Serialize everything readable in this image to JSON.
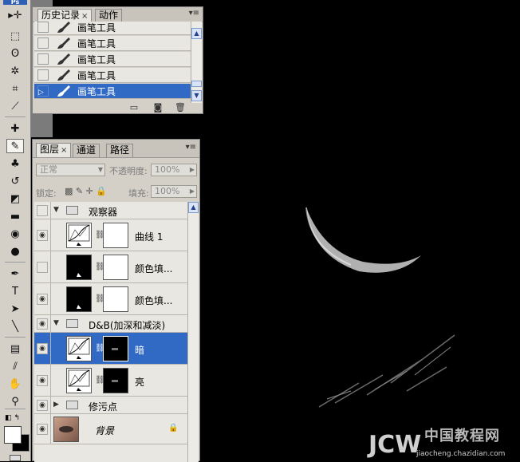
{
  "toolbox": {
    "logo": "Ps",
    "tools": [
      {
        "name": "move-icon",
        "glyph": "▸✛"
      },
      {
        "name": "marquee-icon",
        "glyph": "⬚"
      },
      {
        "name": "lasso-icon",
        "glyph": "ʘ"
      },
      {
        "name": "magic-wand-icon",
        "glyph": "✲"
      },
      {
        "name": "crop-icon",
        "glyph": "⌗"
      },
      {
        "name": "slice-icon",
        "glyph": "⟋"
      },
      {
        "name": "healing-brush-icon",
        "glyph": "✚"
      },
      {
        "name": "brush-icon",
        "glyph": "✎"
      },
      {
        "name": "clone-stamp-icon",
        "glyph": "♣"
      },
      {
        "name": "history-brush-icon",
        "glyph": "↺"
      },
      {
        "name": "eraser-icon",
        "glyph": "◩"
      },
      {
        "name": "gradient-icon",
        "glyph": "▬"
      },
      {
        "name": "blur-icon",
        "glyph": "◉"
      },
      {
        "name": "dodge-icon",
        "glyph": "●"
      },
      {
        "name": "pen-icon",
        "glyph": "✒"
      },
      {
        "name": "type-icon",
        "glyph": "T"
      },
      {
        "name": "path-select-icon",
        "glyph": "➤"
      },
      {
        "name": "line-icon",
        "glyph": "╲"
      },
      {
        "name": "notes-icon",
        "glyph": "▤"
      },
      {
        "name": "eyedropper-icon",
        "glyph": "⫽"
      },
      {
        "name": "hand-icon",
        "glyph": "✋"
      },
      {
        "name": "zoom-icon",
        "glyph": "⚲"
      }
    ]
  },
  "history": {
    "tabs": [
      {
        "label": "历史记录",
        "close": "×"
      },
      {
        "label": "动作"
      }
    ],
    "rows": [
      {
        "label": "画笔工具",
        "selected": false
      },
      {
        "label": "画笔工具",
        "selected": false
      },
      {
        "label": "画笔工具",
        "selected": false
      },
      {
        "label": "画笔工具",
        "selected": false
      },
      {
        "label": "画笔工具",
        "selected": true
      }
    ],
    "footer": [
      "new-doc-icon",
      "snapshot-icon",
      "trash-icon"
    ]
  },
  "layers_panel": {
    "tabs": [
      {
        "label": "图层",
        "close": "×"
      },
      {
        "label": "通道"
      },
      {
        "label": "路径"
      }
    ],
    "blend_mode": "正常",
    "opacity_label": "不透明度:",
    "opacity_value": "100%",
    "lock_label": "锁定:",
    "fill_label": "填充:",
    "fill_value": "100%",
    "layers": [
      {
        "type": "group",
        "name": "观察器",
        "visible": false,
        "expanded": true,
        "indent": 0
      },
      {
        "type": "adjustment",
        "name": "曲线 1",
        "visible": true,
        "indent": 1,
        "thumb": "curves",
        "mask": "white"
      },
      {
        "type": "fill",
        "name": "颜色填...",
        "visible": false,
        "indent": 1,
        "thumb": "black",
        "mask": "white"
      },
      {
        "type": "fill",
        "name": "颜色填...",
        "visible": true,
        "indent": 1,
        "thumb": "black",
        "mask": "white"
      },
      {
        "type": "group",
        "name": "D&B(加深和减淡)",
        "visible": true,
        "expanded": true,
        "indent": 0
      },
      {
        "type": "adjustment",
        "name": "暗",
        "visible": true,
        "indent": 1,
        "thumb": "curves",
        "mask": "dark",
        "selected": true
      },
      {
        "type": "adjustment",
        "name": "亮",
        "visible": true,
        "indent": 1,
        "thumb": "curves",
        "mask": "dark"
      },
      {
        "type": "group",
        "name": "修污点",
        "visible": true,
        "expanded": false,
        "indent": 0
      },
      {
        "type": "background",
        "name": "背景",
        "visible": true,
        "indent": 0,
        "locked": true
      }
    ]
  },
  "canvas": {
    "background": "#000000"
  },
  "watermark": {
    "line1": "中国教程网",
    "line2": "JCW",
    "line3": "jiaocheng.chazidian.com"
  },
  "colors": {
    "selection": "#316ac5",
    "panel_bg": "#d4d0c8",
    "list_bg": "#e9e7e1"
  }
}
